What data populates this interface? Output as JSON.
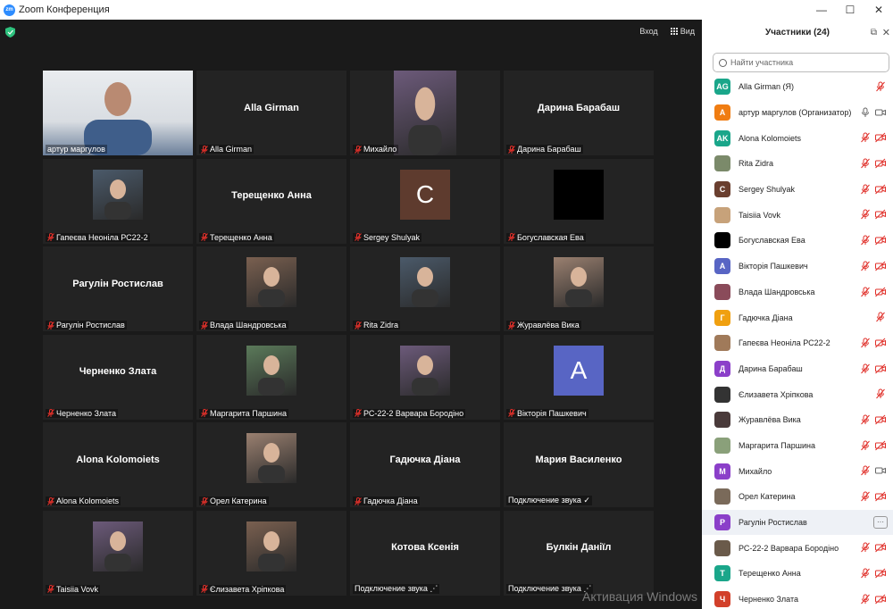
{
  "window": {
    "title": "Zoom Конференция",
    "logo_text": "zm"
  },
  "toolbar": {
    "signin": "Вход",
    "view": "Вид"
  },
  "tiles": [
    {
      "name": "артур маргулов",
      "kind": "video",
      "active": true,
      "mic_off": false
    },
    {
      "name": "Alla Girman",
      "kind": "name",
      "big": "Alla Girman",
      "mic_off": true
    },
    {
      "name": "Михайло",
      "kind": "photo-wide",
      "mic_off": true
    },
    {
      "name": "Дарина Барабаш",
      "kind": "name",
      "big": "Дарина Барабаш",
      "mic_off": true
    },
    {
      "name": "Гапеєва Неоніла РС22-2",
      "kind": "photo",
      "mic_off": true
    },
    {
      "name": "Терещенко Анна",
      "kind": "name",
      "big": "Терещенко Анна",
      "mic_off": true
    },
    {
      "name": "Sergey Shulyak",
      "kind": "letter",
      "letter": "C",
      "color": "#5e3b2e",
      "mic_off": true
    },
    {
      "name": "Богуславская Ева",
      "kind": "black",
      "mic_off": true
    },
    {
      "name": "Рагулін Ростислав",
      "kind": "name",
      "big": "Рагулін Ростислав",
      "mic_off": true
    },
    {
      "name": "Влада Шандровська",
      "kind": "photo",
      "mic_off": true
    },
    {
      "name": "Rita Zidra",
      "kind": "photo",
      "mic_off": true
    },
    {
      "name": "Журавлёва Вика",
      "kind": "photo",
      "mic_off": true
    },
    {
      "name": "Черненко Злата",
      "kind": "name",
      "big": "Черненко Злата",
      "mic_off": true
    },
    {
      "name": "Маргарита Паршина",
      "kind": "photo",
      "mic_off": true
    },
    {
      "name": "РС-22-2 Варвара Бородіно",
      "kind": "photo",
      "mic_off": true
    },
    {
      "name": "Вікторія Пашкевич",
      "kind": "letter",
      "letter": "A",
      "color": "#5865c4",
      "mic_off": true
    },
    {
      "name": "Alona Kolomoiets",
      "kind": "name",
      "big": "Alona Kolomoiets",
      "mic_off": true
    },
    {
      "name": "Орел Катерина",
      "kind": "photo",
      "mic_off": true
    },
    {
      "name": "Гадючка Діана",
      "kind": "name",
      "big": "Гадючка Діана",
      "mic_off": true
    },
    {
      "name": "Подключение звука ✓",
      "kind": "name",
      "big": "Мария Василенко",
      "mic_off": false
    },
    {
      "name": "Taisiia Vovk",
      "kind": "photo",
      "mic_off": true
    },
    {
      "name": "Єлизавета Хріпкова",
      "kind": "photo",
      "mic_off": true
    },
    {
      "name": "Подключение звука ⋰",
      "kind": "name",
      "big": "Котова Ксенія",
      "mic_off": false
    },
    {
      "name": "Подключение звука ⋰",
      "kind": "name",
      "big": "Булкін Даніїл",
      "mic_off": false
    }
  ],
  "panel": {
    "title": "Участники (24)",
    "search_placeholder": "Найти участника",
    "participants": [
      {
        "name": "Alla Girman (Я)",
        "initials": "AG",
        "color": "#1aa68a",
        "icons": [
          "mic-off"
        ]
      },
      {
        "name": "артур маргулов (Организатор)",
        "initials": "А",
        "color": "#f07d12",
        "icons": [
          "mic-on",
          "video-on"
        ]
      },
      {
        "name": "Alona Kolomoiets",
        "initials": "AK",
        "color": "#1aa68a",
        "icons": [
          "mic-off",
          "video-off"
        ]
      },
      {
        "name": "Rita Zidra",
        "initials": "",
        "color": "#7b8a6a",
        "icons": [
          "mic-off",
          "video-off"
        ]
      },
      {
        "name": "Sergey Shulyak",
        "initials": "C",
        "color": "#6a3f2f",
        "icons": [
          "mic-off",
          "video-off"
        ]
      },
      {
        "name": "Taisiia Vovk",
        "initials": "",
        "color": "#c7a27a",
        "icons": [
          "mic-off",
          "video-off"
        ]
      },
      {
        "name": "Богуславская Ева",
        "initials": "",
        "color": "#000000",
        "icons": [
          "mic-off",
          "video-off"
        ]
      },
      {
        "name": "Вікторія Пашкевич",
        "initials": "А",
        "color": "#5865c4",
        "icons": [
          "mic-off",
          "video-off"
        ]
      },
      {
        "name": "Влада Шандровська",
        "initials": "",
        "color": "#8a4b5a",
        "icons": [
          "mic-off",
          "video-off"
        ]
      },
      {
        "name": "Гадючка Діана",
        "initials": "Г",
        "color": "#f0a010",
        "icons": [
          "mic-off"
        ]
      },
      {
        "name": "Гапеєва Неоніла РС22-2",
        "initials": "",
        "color": "#a07a5a",
        "icons": [
          "mic-off",
          "video-off"
        ]
      },
      {
        "name": "Дарина Барабаш",
        "initials": "Д",
        "color": "#8b3fc9",
        "icons": [
          "mic-off",
          "video-off"
        ]
      },
      {
        "name": "Єлизавета Хріпкова",
        "initials": "",
        "color": "#333333",
        "icons": [
          "mic-off"
        ]
      },
      {
        "name": "Журавлёва Вика",
        "initials": "",
        "color": "#4a3a3a",
        "icons": [
          "mic-off",
          "video-off"
        ]
      },
      {
        "name": "Маргарита Паршина",
        "initials": "",
        "color": "#8aa07a",
        "icons": [
          "mic-off",
          "video-off"
        ]
      },
      {
        "name": "Михайло",
        "initials": "М",
        "color": "#8b3fc9",
        "icons": [
          "mic-off",
          "video-on"
        ]
      },
      {
        "name": "Орел Катерина",
        "initials": "",
        "color": "#7a6a5a",
        "icons": [
          "mic-off",
          "video-off"
        ]
      },
      {
        "name": "Рагулін Ростислав",
        "initials": "Р",
        "color": "#8b3fc9",
        "icons": [
          "more"
        ]
      },
      {
        "name": "РС-22-2 Варвара Бородіно",
        "initials": "",
        "color": "#6a5a4a",
        "icons": [
          "mic-off",
          "video-off"
        ]
      },
      {
        "name": "Терещенко Анна",
        "initials": "Т",
        "color": "#1aa68a",
        "icons": [
          "mic-off",
          "video-off"
        ]
      },
      {
        "name": "Черненко Злата",
        "initials": "Ч",
        "color": "#d2402a",
        "icons": [
          "mic-off",
          "video-off"
        ]
      }
    ],
    "more_label": "···"
  },
  "watermark": "Активация Windows",
  "colors": {
    "active_speaker": "#c7e25c",
    "muted": "#e0302a",
    "accent": "#2d8cff"
  }
}
